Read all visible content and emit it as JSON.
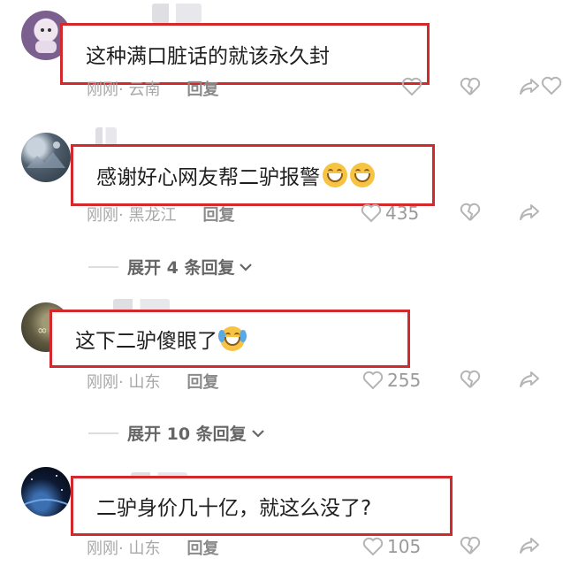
{
  "comments": [
    {
      "text": "这种满口脏话的就该永久封",
      "time": "刚刚",
      "location": "· 云南",
      "reply_label": "回复",
      "likes": "",
      "avatar_icon": "cartoon-avatar-icon"
    },
    {
      "text": "感谢好心网友帮二驴报警",
      "time": "刚刚",
      "location": "· 黑龙江",
      "reply_label": "回复",
      "likes": "435",
      "avatar_icon": "nature-avatar-icon"
    },
    {
      "text": "这下二驴傻眼了",
      "time": "刚刚",
      "location": "· 山东",
      "reply_label": "回复",
      "likes": "255",
      "avatar_icon": "dark-avatar-icon"
    },
    {
      "text": "二驴身价几十亿，就这么没了?",
      "time": "刚刚",
      "location": "· 山东",
      "reply_label": "回复",
      "likes": "105",
      "avatar_icon": "earth-avatar-icon"
    }
  ],
  "expand_replies": [
    {
      "label": "展开 4 条回复"
    },
    {
      "label": "展开 10 条回复"
    }
  ],
  "colors": {
    "highlight_border": "#d3292c",
    "meta_text": "#a8a8a8"
  }
}
